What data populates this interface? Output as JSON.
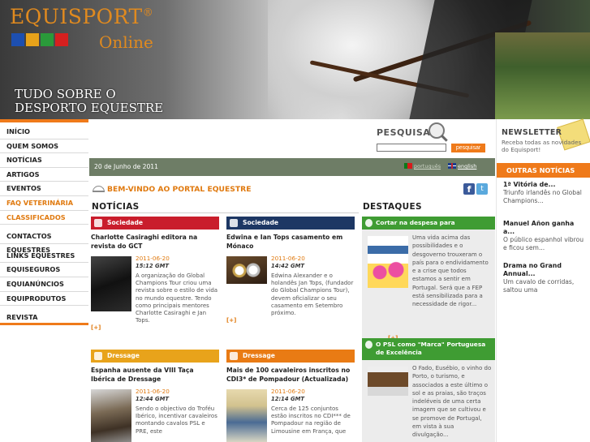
{
  "banner": {
    "logo_title": "EQUISPORT",
    "logo_reg": "®",
    "logo_sub": "Online",
    "tagline_line1": "TUDO SOBRE O",
    "tagline_line2": "DESPORTO EQUESTRE",
    "icon_colors": [
      "#1d4fb0",
      "#e7a21a",
      "#2a9a3a",
      "#d6201f"
    ]
  },
  "nav": {
    "items": [
      {
        "label": "INÍCIO"
      },
      {
        "label": "QUEM SOMOS"
      },
      {
        "label": "NOTÍCIAS"
      },
      {
        "label": "ARTIGOS"
      },
      {
        "label": "EVENTOS"
      },
      {
        "label": "FAQ VETERINÁRIA"
      },
      {
        "label": "CLASSIFICADOS"
      },
      {
        "label": "CONTACTOS EQUESTRES"
      },
      {
        "label": "LINKS EQUESTRES"
      },
      {
        "label": "EQUISEGUROS"
      },
      {
        "label": "EQUIANÚNCIOS"
      },
      {
        "label": "EQUIPRODUTOS"
      },
      {
        "label": "REVISTA"
      }
    ]
  },
  "search": {
    "title": "PESQUISA",
    "button_label": "pesquisar",
    "input_value": ""
  },
  "newsletter": {
    "title": "NEWSLETTER",
    "text": "Receba todas as novidades do Equisport!"
  },
  "outras": {
    "header": "OUTRAS NOTÍCIAS",
    "items": [
      {
        "title": "1ª Vitória de...",
        "text": "Triunfo irlandês no Global Champions..."
      },
      {
        "title": "Manuel Añon ganha a...",
        "text": "O público espanhol vibrou e ficou sem..."
      },
      {
        "title": "Drama no Grand Annual...",
        "text": "Um cavalo de corridas, saltou uma"
      }
    ]
  },
  "datebar": {
    "date": "20 de Junho de 2011",
    "lang_pt": "português",
    "lang_en": "english"
  },
  "welcome": {
    "text": "BEM-VINDO AO PORTAL EQUESTRE",
    "fb": "f",
    "tw": "t"
  },
  "sections": {
    "noticias": "NOTÍCIAS",
    "destaques": "DESTAQUES"
  },
  "news": [
    {
      "category": "Sociedade",
      "title": "Charlotte Casiraghi editora na revista do GCT",
      "date": "2011-06-20",
      "time": "15:12 GMT",
      "intro": "A organização do Global Champions Tour criou uma revista sobre o estilo de vida no mundo equestre. Tendo como principais mentores Charlotte Casiraghi e Jan Tops.",
      "more": "[+]"
    },
    {
      "category": "Sociedade",
      "title": "Edwina e Ian Tops casamento em Mónaco",
      "date": "2011-06-20",
      "time": "14:42 GMT",
      "intro": "Edwina Alexander e o holandês Jan Tops, (fundador do Global Champions Tour), devem oficializar o seu casamento em Setembro próximo.",
      "more": "[+]"
    },
    {
      "category": "Dressage",
      "title": "Espanha ausente da VIII Taça Ibérica de Dressage",
      "date": "2011-06-20",
      "time": "12:44 GMT",
      "intro": "Sendo o objectivo do Troféu Ibérico, incentivar cavaleiros montando cavalos PSL e PRE, este",
      "more": ""
    },
    {
      "category": "Dressage",
      "title": "Mais de 100 cavaleiros inscritos no CDI3* de Pompadour (Actualizada)",
      "date": "2011-06-20",
      "time": "12:14 GMT",
      "intro": "Cerca de 125 conjuntos estão inscritos no CDI*** de Pompadour na região de Limousine em França, que",
      "more": ""
    }
  ],
  "destaques": [
    {
      "title": "Cortar na despesa para racionalizar...",
      "text": "Uma vida acima das possibilidades e o desgoverno trouxeram o país para o endividamento e a crise que todos estamos a sentir em Portugal. Será que a FEP está sensibilizada para a necessidade de rigor...",
      "more": "[+]"
    },
    {
      "title": "O PSL como \"Marca\" Portuguesa de Excelência",
      "text": "O Fado, Eusébio, o vinho do Porto, o turismo, e associados a este último o sol e as praias, são traços indeléveis de uma certa imagem que se cultivou e se promove de Portugal, em vista à sua divulgação...",
      "more": "[+]"
    }
  ]
}
